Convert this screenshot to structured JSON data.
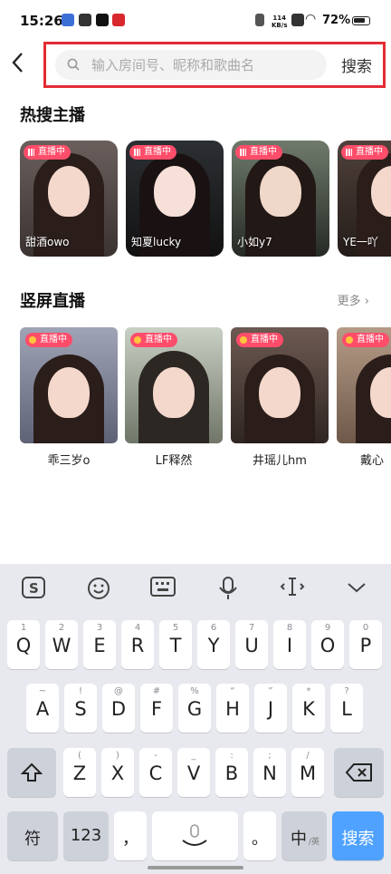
{
  "status_bar": {
    "time": "15:26",
    "net_speed_value": "114",
    "net_speed_unit": "KB/s",
    "battery": "72%"
  },
  "header": {
    "back_label": "<",
    "search_placeholder": "输入房间号、昵称和歌曲名",
    "search_button": "搜索",
    "accent_color": "#e32b34"
  },
  "hot_section": {
    "title": "热搜主播",
    "live_badge": "直播中",
    "cards": [
      {
        "name": "甜酒owo"
      },
      {
        "name": "知夏lucky"
      },
      {
        "name": "小如y7"
      },
      {
        "name": "YE一吖"
      }
    ]
  },
  "vertical_section": {
    "title": "竖屏直播",
    "more": "更多",
    "live_badge": "直播中",
    "cards": [
      {
        "name": "乖三岁o"
      },
      {
        "name": "LF释然"
      },
      {
        "name": "井瑶儿hm"
      },
      {
        "name": "戴心"
      }
    ]
  },
  "keyboard": {
    "toolbar": [
      "sogou-logo-icon",
      "emoji-icon",
      "keyboard-icon",
      "microphone-icon",
      "cursor-icon",
      "collapse-icon"
    ],
    "row1": [
      {
        "sub": "1",
        "main": "Q"
      },
      {
        "sub": "2",
        "main": "W"
      },
      {
        "sub": "3",
        "main": "E"
      },
      {
        "sub": "4",
        "main": "R"
      },
      {
        "sub": "5",
        "main": "T"
      },
      {
        "sub": "6",
        "main": "Y"
      },
      {
        "sub": "7",
        "main": "U"
      },
      {
        "sub": "8",
        "main": "I"
      },
      {
        "sub": "9",
        "main": "O"
      },
      {
        "sub": "0",
        "main": "P"
      }
    ],
    "row2": [
      {
        "sub": "~",
        "main": "A"
      },
      {
        "sub": "!",
        "main": "S"
      },
      {
        "sub": "@",
        "main": "D"
      },
      {
        "sub": "#",
        "main": "F"
      },
      {
        "sub": "%",
        "main": "G"
      },
      {
        "sub": "“",
        "main": "H"
      },
      {
        "sub": "”",
        "main": "J"
      },
      {
        "sub": "*",
        "main": "K"
      },
      {
        "sub": "?",
        "main": "L"
      }
    ],
    "row3": [
      {
        "sub": "(",
        "main": "Z"
      },
      {
        "sub": ")",
        "main": "X"
      },
      {
        "sub": "-",
        "main": "C"
      },
      {
        "sub": "_",
        "main": "V"
      },
      {
        "sub": ":",
        "main": "B"
      },
      {
        "sub": ";",
        "main": "N"
      },
      {
        "sub": "/",
        "main": "M"
      }
    ],
    "symbol_key": "符",
    "num_key": "123",
    "comma_key": "，",
    "period_key": "。",
    "lang_key": "中",
    "lang_sub": "/英",
    "search_key": "搜索"
  }
}
